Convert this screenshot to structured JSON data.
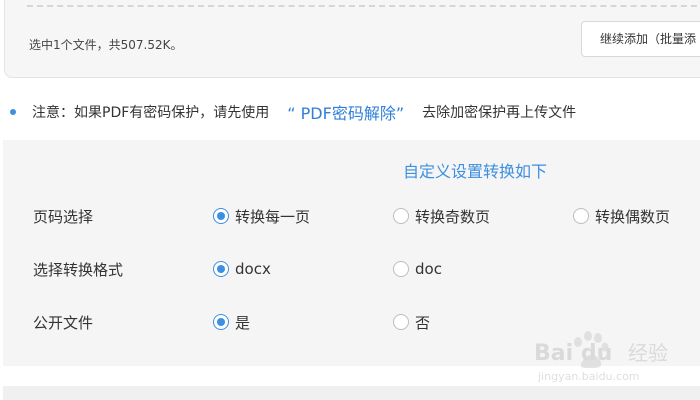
{
  "upload": {
    "summary": "选中1个文件，共507.52K。",
    "add_more_label": "继续添加（批量添"
  },
  "notice": {
    "prefix": "注意：如果PDF有密码保护，请先使用",
    "link": "“ PDF密码解除”",
    "suffix": "去除加密保护再上传文件"
  },
  "settings": {
    "title": "自定义设置转换如下",
    "rows": [
      {
        "label": "页码选择",
        "options": [
          {
            "label": "转换每一页",
            "checked": true
          },
          {
            "label": "转换奇数页",
            "checked": false
          },
          {
            "label": "转换偶数页",
            "checked": false
          }
        ]
      },
      {
        "label": "选择转换格式",
        "options": [
          {
            "label": "docx",
            "checked": true
          },
          {
            "label": "doc",
            "checked": false
          }
        ]
      },
      {
        "label": "公开文件",
        "options": [
          {
            "label": "是",
            "checked": true
          },
          {
            "label": "否",
            "checked": false
          }
        ]
      }
    ]
  },
  "watermark": {
    "brand": "Baidu经验",
    "url": "jingyan.baidu.com"
  },
  "colors": {
    "accent": "#3d8fe0",
    "link": "#2f7fd9",
    "panel_bg": "#f5f5f5"
  }
}
